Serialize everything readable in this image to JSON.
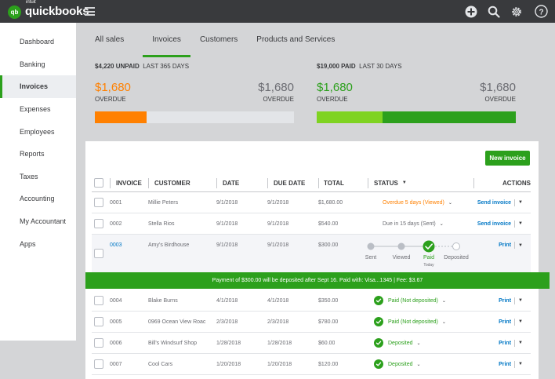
{
  "brand": {
    "intuit": "intuit",
    "name": "quickbooks"
  },
  "topbar": {
    "icons": [
      "plus-icon",
      "search-icon",
      "gear-icon",
      "help-icon"
    ]
  },
  "sidebar": {
    "items": [
      {
        "label": "Dashboard",
        "active": false
      },
      {
        "label": "Banking",
        "active": false
      },
      {
        "label": "Invoices",
        "active": true
      },
      {
        "label": "Expenses",
        "active": false
      },
      {
        "label": "Employees",
        "active": false
      },
      {
        "label": "Reports",
        "active": false
      },
      {
        "label": "Taxes",
        "active": false
      },
      {
        "label": "Accounting",
        "active": false
      },
      {
        "label": "My Accountant",
        "active": false
      },
      {
        "label": "Apps",
        "active": false
      }
    ]
  },
  "tabs": [
    {
      "label": "All sales",
      "active": false
    },
    {
      "label": "Invoices",
      "active": true
    },
    {
      "label": "Customers",
      "active": false
    },
    {
      "label": "Products and Services",
      "active": false
    }
  ],
  "unpaid": {
    "amount": "$4,220 UNPAID",
    "period": "LAST 365 DAYS",
    "left_value": "$1,680",
    "left_label": "OVERDUE",
    "right_value": "$1,680",
    "right_label": "OVERDUE",
    "bar_fraction": 0.26,
    "bar_color": "#ff8000"
  },
  "paid": {
    "amount": "$19,000 PAID",
    "period": "LAST 30 DAYS",
    "left_value": "$1,680",
    "left_label": "OVERDUE",
    "right_value": "$1,680",
    "right_label": "OVERDUE",
    "bar_fraction": 0.33,
    "bar_color_light": "#7fd321",
    "bar_color_dark": "#2ca01c"
  },
  "new_invoice_label": "New invoice",
  "table": {
    "headers": {
      "invoice": "INVOICE",
      "customer": "CUSTOMER",
      "date": "DATE",
      "due_date": "DUE DATE",
      "total": "TOTAL",
      "status": "STATUS",
      "actions": "ACTIONS"
    },
    "rows": [
      {
        "invoice": "0001",
        "customer": "Millie Peters",
        "date": "9/1/2018",
        "due": "9/1/2018",
        "total": "$1,680.00",
        "status": "Overdue 5 days (Viewed)",
        "status_type": "orange",
        "action": "Send invoice"
      },
      {
        "invoice": "0002",
        "customer": "Stella Rios",
        "date": "9/1/2018",
        "due": "9/1/2018",
        "total": "$540.00",
        "status": "Due in 15 days (Sent)",
        "status_type": "gray",
        "action": "Send invoice"
      },
      {
        "invoice": "0003",
        "customer": "Amy's Birdhouse",
        "date": "9/1/2018",
        "due": "9/1/2018",
        "total": "$300.00",
        "status": "",
        "status_type": "progress",
        "action": "Print"
      },
      {
        "invoice": "0004",
        "customer": "Blake Burns",
        "date": "4/1/2018",
        "due": "4/1/2018",
        "total": "$350.00",
        "status": "Paid (Not deposited)",
        "status_type": "green",
        "action": "Print"
      },
      {
        "invoice": "0005",
        "customer": "0969 Ocean View Roac",
        "date": "2/3/2018",
        "due": "2/3/2018",
        "total": "$780.00",
        "status": "Paid (Not deposited)",
        "status_type": "green",
        "action": "Print"
      },
      {
        "invoice": "0006",
        "customer": "Bill's Windsurf Shop",
        "date": "1/28/2018",
        "due": "1/28/2018",
        "total": "$60.00",
        "status": "Deposited",
        "status_type": "green",
        "action": "Print"
      },
      {
        "invoice": "0007",
        "customer": "Cool Cars",
        "date": "1/20/2018",
        "due": "1/20/2018",
        "total": "$120.00",
        "status": "Deposited",
        "status_type": "green",
        "action": "Print"
      }
    ]
  },
  "progress": {
    "steps": [
      {
        "label": "Sent",
        "state": "done"
      },
      {
        "label": "Viewed",
        "state": "done"
      },
      {
        "label": "Paid",
        "state": "current",
        "sub": "Today"
      },
      {
        "label": "Deposited",
        "state": "todo"
      }
    ]
  },
  "banner": {
    "text": "Payment of $300.00 will be deposited after Sept 16. Paid with: Visa...1345   |   Fee: $3.67"
  }
}
